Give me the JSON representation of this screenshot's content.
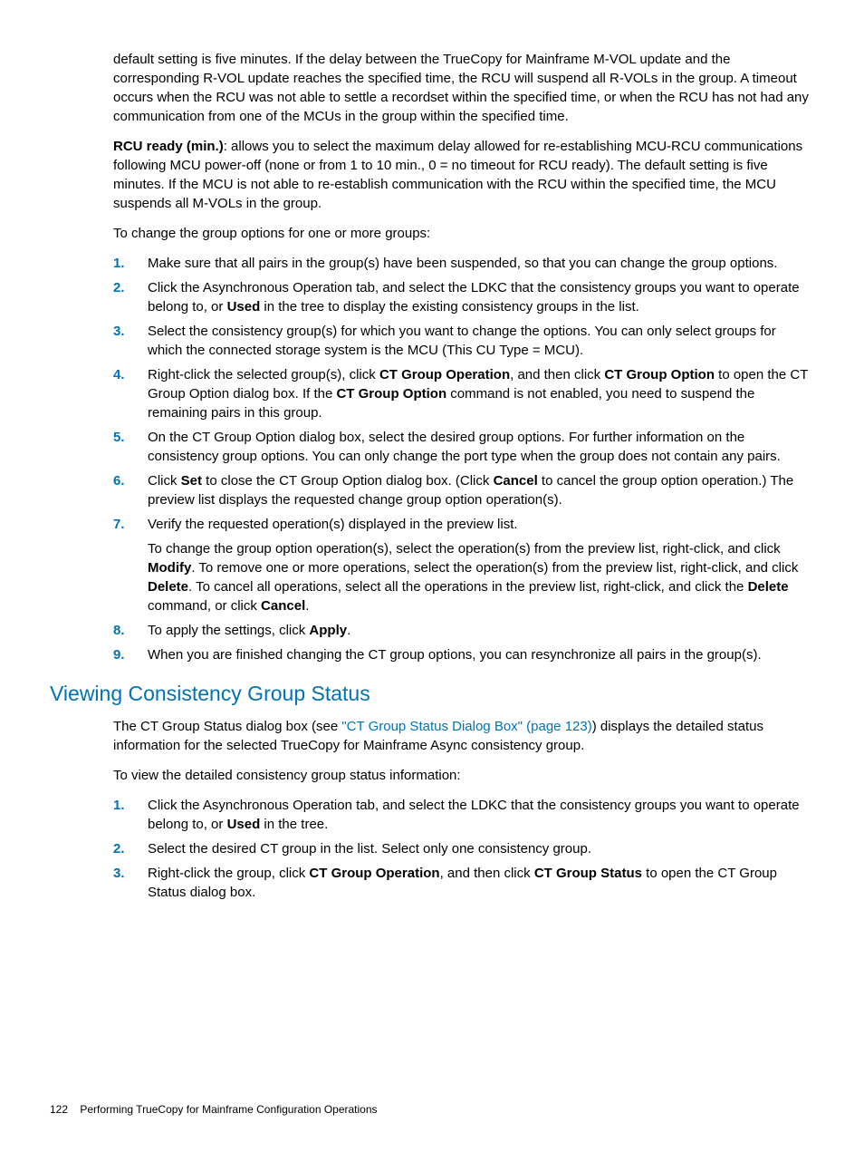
{
  "p_intro": "default setting is five minutes. If the delay between the TrueCopy for Mainframe M-VOL update and the corresponding R-VOL update reaches the specified time, the RCU will suspend all R-VOLs in the group. A timeout occurs when the RCU was not able to settle a recordset within the specified time, or when the RCU has not had any communication from one of the MCUs in the group within the specified time.",
  "p_rcu_label": "RCU ready (min.)",
  "p_rcu_text": ": allows you to select the maximum delay allowed for re-establishing MCU-RCU communications following MCU power-off (none or from 1 to 10 min., 0 = no timeout for RCU ready). The default setting is five minutes. If the MCU is not able to re-establish communication with the RCU within the specified time, the MCU suspends all M-VOLs in the group.",
  "p_change": "To change the group options for one or more groups:",
  "list1": {
    "i1": "Make sure that all pairs in the group(s) have been suspended, so that you can change the group options.",
    "i2a": "Click the Asynchronous Operation tab, and select the LDKC that the consistency groups you want to operate belong to, or ",
    "i2b": "Used",
    "i2c": " in the tree to display the existing consistency groups in the list.",
    "i3": "Select the consistency group(s) for which you want to change the options. You can only select groups for which the connected storage system is the MCU (This CU Type = MCU).",
    "i4a": "Right-click the selected group(s), click ",
    "i4b": "CT Group Operation",
    "i4c": ", and then click ",
    "i4d": "CT Group Option",
    "i4e": " to open the CT Group Option dialog box. If the ",
    "i4f": "CT Group Option",
    "i4g": " command is not enabled, you need to suspend the remaining pairs in this group.",
    "i5": "On the CT Group Option dialog box, select the desired group options. For further information on the consistency group options. You can only change the port type when the group does not contain any pairs.",
    "i6a": "Click ",
    "i6b": "Set",
    "i6c": " to close the CT Group Option dialog box. (Click ",
    "i6d": "Cancel",
    "i6e": " to cancel the group option operation.) The preview list displays the requested change group option operation(s).",
    "i7": "Verify the requested operation(s) displayed in the preview list.",
    "i7sa": "To change the group option operation(s), select the operation(s) from the preview list, right-click, and click ",
    "i7sb": "Modify",
    "i7sc": ". To remove one or more operations, select the operation(s) from the preview list, right-click, and click ",
    "i7sd": "Delete",
    "i7se": ". To cancel all operations, select all the operations in the preview list, right-click, and click the ",
    "i7sf": "Delete",
    "i7sg": " command, or click ",
    "i7sh": "Cancel",
    "i7si": ".",
    "i8a": "To apply the settings, click ",
    "i8b": "Apply",
    "i8c": ".",
    "i9": "When you are finished changing the CT group options, you can resynchronize all pairs in the group(s)."
  },
  "h2": "Viewing Consistency Group Status",
  "p_ct1a": "The CT Group Status dialog box (see ",
  "p_ct1b": "\"CT Group Status Dialog Box\" (page 123)",
  "p_ct1c": ") displays the detailed status information for the selected TrueCopy for Mainframe Async consistency group.",
  "p_ct2": "To view the detailed consistency group status information:",
  "list2": {
    "i1a": "Click the Asynchronous Operation tab, and select the LDKC that the consistency groups you want to operate belong to, or ",
    "i1b": "Used",
    "i1c": " in the tree.",
    "i2": "Select the desired CT group in the list. Select only one consistency group.",
    "i3a": "Right-click the group, click ",
    "i3b": "CT Group Operation",
    "i3c": ", and then click ",
    "i3d": "CT Group Status",
    "i3e": " to open the CT Group Status dialog box."
  },
  "footer": {
    "page": "122",
    "title": "Performing TrueCopy for Mainframe Configuration Operations"
  }
}
